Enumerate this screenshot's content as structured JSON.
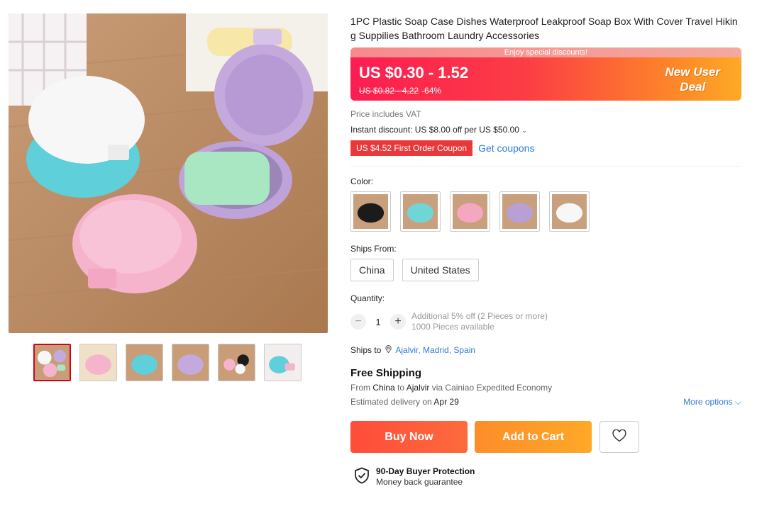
{
  "product": {
    "title": "1PC Plastic Soap Case Dishes Waterproof Leakproof Soap Box With Cover Travel Hiking Suppilies Bathroom Laundry Accessories"
  },
  "gallery": {
    "thumbnails": [
      "thumb-1",
      "thumb-2",
      "thumb-3",
      "thumb-4",
      "thumb-5",
      "thumb-6"
    ],
    "active_index": 0
  },
  "price": {
    "banner_top": "Enjoy special discounts!",
    "current": "US $0.30 - 1.52",
    "original": "US $0.82 - 4.22",
    "discount": "-64%",
    "deal_line1": "New User",
    "deal_line2": "Deal",
    "vat_note": "Price includes VAT",
    "instant_discount": "Instant discount: US $8.00 off per US $50.00",
    "instant_chevron": "⌄",
    "coupon": "US $4.52 First Order Coupon",
    "get_coupons": "Get coupons"
  },
  "colors": {
    "label": "Color:",
    "options": [
      {
        "name": "black",
        "hex": "#1b1b1b"
      },
      {
        "name": "blue",
        "hex": "#6fd6d8"
      },
      {
        "name": "pink",
        "hex": "#f6a7c0"
      },
      {
        "name": "purple",
        "hex": "#b8a0d6"
      },
      {
        "name": "white",
        "hex": "#f7f7f7"
      }
    ]
  },
  "ships_from": {
    "label": "Ships From:",
    "options": [
      "China",
      "United States"
    ]
  },
  "quantity": {
    "label": "Quantity:",
    "value": "1",
    "minus": "−",
    "plus": "+",
    "promo": "Additional 5% off (2 Pieces or more)",
    "available": "1000 Pieces available"
  },
  "shipping": {
    "ships_to_label": "Ships to",
    "location": "Ajalvir, Madrid, Spain",
    "free_shipping": "Free Shipping",
    "from_label": "From",
    "from": "China",
    "to_label": "to",
    "to": "Ajalvir",
    "via": "via Cainiao Expedited Economy",
    "eta_label": "Estimated delivery on",
    "eta": "Apr 29",
    "more_options": "More options ⌵"
  },
  "actions": {
    "buy_now": "Buy Now",
    "add_to_cart": "Add to Cart"
  },
  "protection": {
    "title": "90-Day Buyer Protection",
    "subtitle": "Money back guarantee"
  },
  "theme": {
    "accent_red": "#fb1d52",
    "accent_orange": "#fdaa26",
    "link_blue": "#2e7dd6"
  }
}
